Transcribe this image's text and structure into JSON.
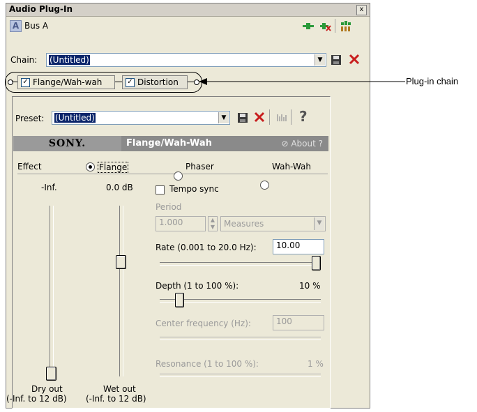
{
  "window": {
    "title": "Audio Plug-In",
    "close_glyph": "x"
  },
  "bus": {
    "label": "Bus A",
    "icon": "A"
  },
  "chain": {
    "label": "Chain:",
    "value": "(Untitled)"
  },
  "plugins": [
    {
      "label": "Flange/Wah-wah",
      "checked": true
    },
    {
      "label": "Distortion",
      "checked": true
    }
  ],
  "callout": {
    "label": "Plug-in chain"
  },
  "preset": {
    "label": "Preset:",
    "value": "(Untitled)"
  },
  "header": {
    "brand": "SONY.",
    "plugin_name": "Flange/Wah-Wah",
    "about": "About ?"
  },
  "effect": {
    "label": "Effect",
    "options": [
      "Flange",
      "Phaser",
      "Wah-Wah"
    ],
    "selected": "Flange"
  },
  "meters": {
    "dry_value": "-Inf.",
    "wet_value": "0.0 dB",
    "dry_label": "Dry out",
    "dry_range": "(-Inf. to 12 dB)",
    "wet_label": "Wet out",
    "wet_range": "(-Inf. to 12 dB)"
  },
  "params": {
    "tempo_sync": "Tempo sync",
    "period_label": "Period",
    "period_value": "1.000",
    "period_unit": "Measures",
    "rate_label": "Rate (0.001 to 20.0 Hz):",
    "rate_value": "10.00",
    "rate_level": 1.0,
    "depth_label": "Depth (1 to 100 %):",
    "depth_value": "10 %",
    "depth_level": 0.1,
    "center_label": "Center frequency (Hz):",
    "center_value": "100",
    "resonance_label": "Resonance (1 to 100 %):",
    "resonance_value": "1 %"
  },
  "colors": {
    "selection": "#0a246a",
    "delete": "#c81e1e",
    "plugin_icon": "#2a9a3a"
  }
}
